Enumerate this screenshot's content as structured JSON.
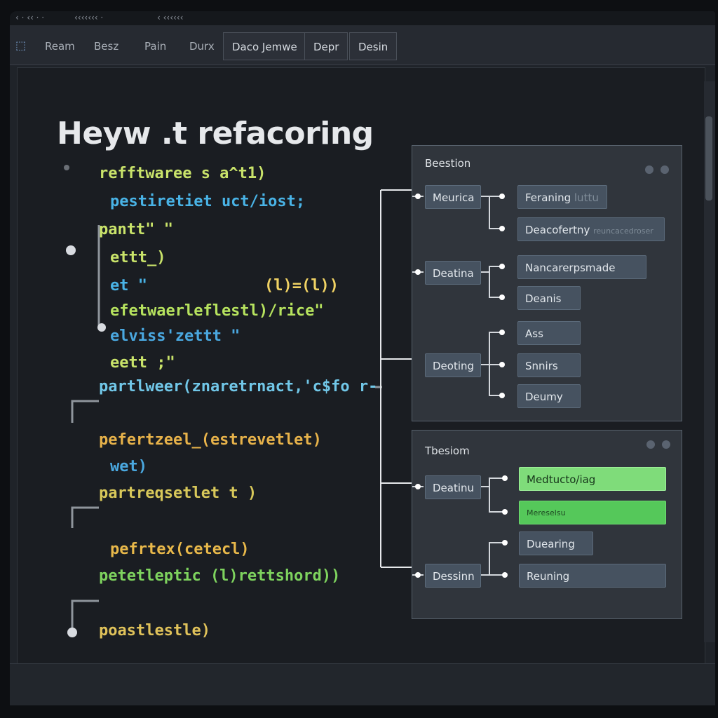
{
  "menubar": {
    "items": [
      "‹ · ‹‹ · ·",
      "‹‹‹‹‹‹‹ ·",
      "‹ ‹‹‹‹‹‹"
    ]
  },
  "tabs": [
    "Ream",
    "Besz",
    "Pain",
    "Durx",
    "Daco Jemwe",
    "Depr",
    "Desin"
  ],
  "heading": "Heyw .t refacoring",
  "code": [
    {
      "text": "refftwaree s a^t1)",
      "color": "#c9e36a"
    },
    {
      "text": "pestiretiet uct/iost;",
      "color": "#49b3e6"
    },
    {
      "text": "pantt\" \"",
      "color": "#c9e36a"
    },
    {
      "text": "ettt_)",
      "color": "#c9e36a"
    },
    {
      "text": "et \"",
      "color": "#49b3e6"
    },
    {
      "text": "(l)=(l))",
      "color": "#f0d264"
    },
    {
      "text": "efetwaerleflestl)/rice\"",
      "color": "#b6e25e"
    },
    {
      "text": "elviss'zettt  \"",
      "color": "#4aa8e0"
    },
    {
      "text": "eett ;\"",
      "color": "#c9e36a"
    },
    {
      "text": "partlweer(znaretrnact,'c$fo r-",
      "color": "#71c7e8"
    },
    {
      "text": "pefertzeel_(estrevetlet)",
      "color": "#e7b24a"
    },
    {
      "text": "wet)",
      "color": "#4aa8e0"
    },
    {
      "text": "partreqsetlet t )",
      "color": "#d8c85a"
    },
    {
      "text": "pefrtex(cetecl)",
      "color": "#e8b84a"
    },
    {
      "text": "petetleptic (l)rettshord))",
      "color": "#7ed35e"
    },
    {
      "text": "poastlestle)",
      "color": "#e0c25a"
    }
  ],
  "panel1": {
    "title": "Beestion",
    "parents": [
      "Meurica",
      "Deatina",
      "Deoting"
    ],
    "children": [
      "Feraning",
      "Deacofertny",
      "Nancarerpsmade",
      "Deanis",
      "Ass",
      "Snnirs",
      "Deumy"
    ],
    "faint": [
      "luttu",
      "reuncacedroser"
    ]
  },
  "panel2": {
    "title": "Tbesiom",
    "parents": [
      "Deatinu",
      "Dessinn"
    ],
    "children": [
      "Medtucto/iag",
      "Mereselsu",
      "Duearing",
      "Reuning"
    ]
  }
}
